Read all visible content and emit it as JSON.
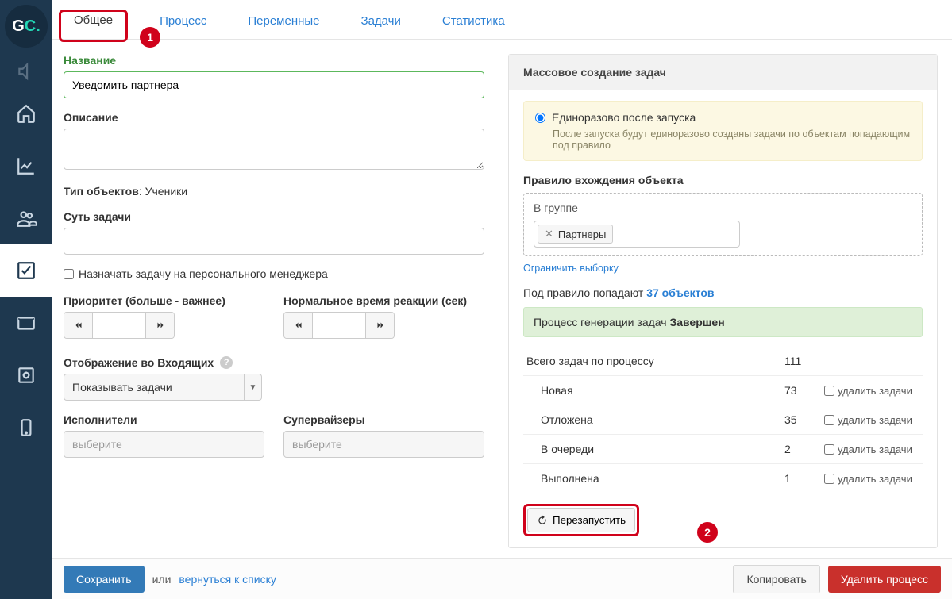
{
  "logo": {
    "g": "G",
    "c": "C."
  },
  "tabs": [
    "Общее",
    "Процесс",
    "Переменные",
    "Задачи",
    "Статистика"
  ],
  "badges": {
    "one": "1",
    "two": "2"
  },
  "left": {
    "name_label": "Название",
    "name_value": "Уведомить партнера",
    "desc_label": "Описание",
    "desc_value": "",
    "obj_type_label": "Тип объектов",
    "obj_type_value": "Ученики",
    "task_subject_label": "Суть задачи",
    "task_subject_value": "",
    "assign_checkbox": "Назначать задачу на персонального менеджера",
    "priority_label": "Приоритет (больше - важнее)",
    "reaction_label": "Нормальное время реакции (сек)",
    "inbox_label": "Отображение во Входящих",
    "inbox_value": "Показывать задачи",
    "executors_label": "Исполнители",
    "executors_placeholder": "выберите",
    "supervisors_label": "Супервайзеры",
    "supervisors_placeholder": "выберите"
  },
  "right": {
    "panel_title": "Массовое создание задач",
    "option_title": "Единоразово после запуска",
    "option_desc": "После запуска будут единоразово созданы задачи по объектам попадающим под правило",
    "rule_label": "Правило вхождения объекта",
    "rule_sub": "В группе",
    "rule_tag": "Партнеры",
    "limit_link": "Ограничить выборку",
    "under_rule_prefix": "Под правило попадают ",
    "under_rule_count": "37 объектов",
    "gen_status_prefix": "Процесс генерации задач ",
    "gen_status": "Завершен",
    "total_label": "Всего задач по процессу",
    "total_value": "111",
    "rows": [
      {
        "name": "Новая",
        "num": "73",
        "del": "удалить задачи"
      },
      {
        "name": "Отложена",
        "num": "35",
        "del": "удалить задачи"
      },
      {
        "name": "В очереди",
        "num": "2",
        "del": "удалить задачи"
      },
      {
        "name": "Выполнена",
        "num": "1",
        "del": "удалить задачи"
      }
    ],
    "restart": "Перезапустить"
  },
  "footer": {
    "save": "Сохранить",
    "or": "или",
    "back": "вернуться к списку",
    "copy": "Копировать",
    "delete": "Удалить процесс"
  }
}
